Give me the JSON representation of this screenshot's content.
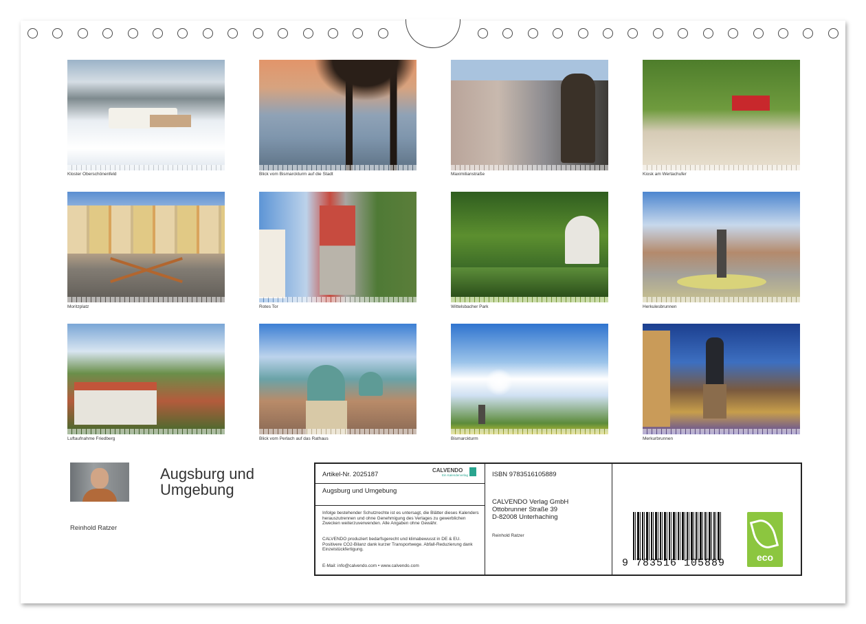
{
  "photos": [
    {
      "caption": "Kloster Oberschönenfeld"
    },
    {
      "caption": "Blick vom Bismarckturm auf die Stadt"
    },
    {
      "caption": "Maximilianstraße"
    },
    {
      "caption": "Kiosk am Wertachufer"
    },
    {
      "caption": "Moritzplatz"
    },
    {
      "caption": "Rotes Tor"
    },
    {
      "caption": "Wittelsbacher Park"
    },
    {
      "caption": "Herkulesbrunnen"
    },
    {
      "caption": "Luftaufnahme Friedberg"
    },
    {
      "caption": "Blick vom Perlach auf das Rathaus"
    },
    {
      "caption": "Bismarckturm"
    },
    {
      "caption": "Merkurbrunnen"
    }
  ],
  "cover": {
    "title": "Augsburg und Umgebung",
    "author": "Reinhold Ratzer"
  },
  "info": {
    "article_nr": "Artikel-Nr. 2025187",
    "publisher_logo": "CALVENDO",
    "publisher_logo_sub": "Ein Kalenderverlag",
    "title": "Augsburg und Umgebung",
    "legal_1": "Infolge bestehender Schutzrechte ist es untersagt, die Blätter dieses Kalenders herauszutrennen und ohne Genehmigung des Verlages zu gewerblichen Zwecken weiterzuverwenden. Alle Angaben ohne Gewähr.",
    "legal_2": "CALVENDO produziert bedarfsgerecht und klimabewusst in DE & EU. Positivere CO2-Bilanz dank kurzer Transportwege. Abfall-Reduzierung dank Einzelstückfertigung.",
    "contact": "E-Mail: info@calvendo.com • www.calvendo.com",
    "isbn": "ISBN 9783516105889",
    "publisher_name": "CALVENDO Verlag GmbH",
    "publisher_street": "Ottobrunner Straße 39",
    "publisher_city": "D-82008 Unterhaching",
    "author": "Reinhold Ratzer",
    "barcode_number": "9  783516  105889",
    "eco_label": "eco",
    "colors": {
      "eco_green": "#8cc63f",
      "logo_green": "#2aa58f"
    }
  }
}
